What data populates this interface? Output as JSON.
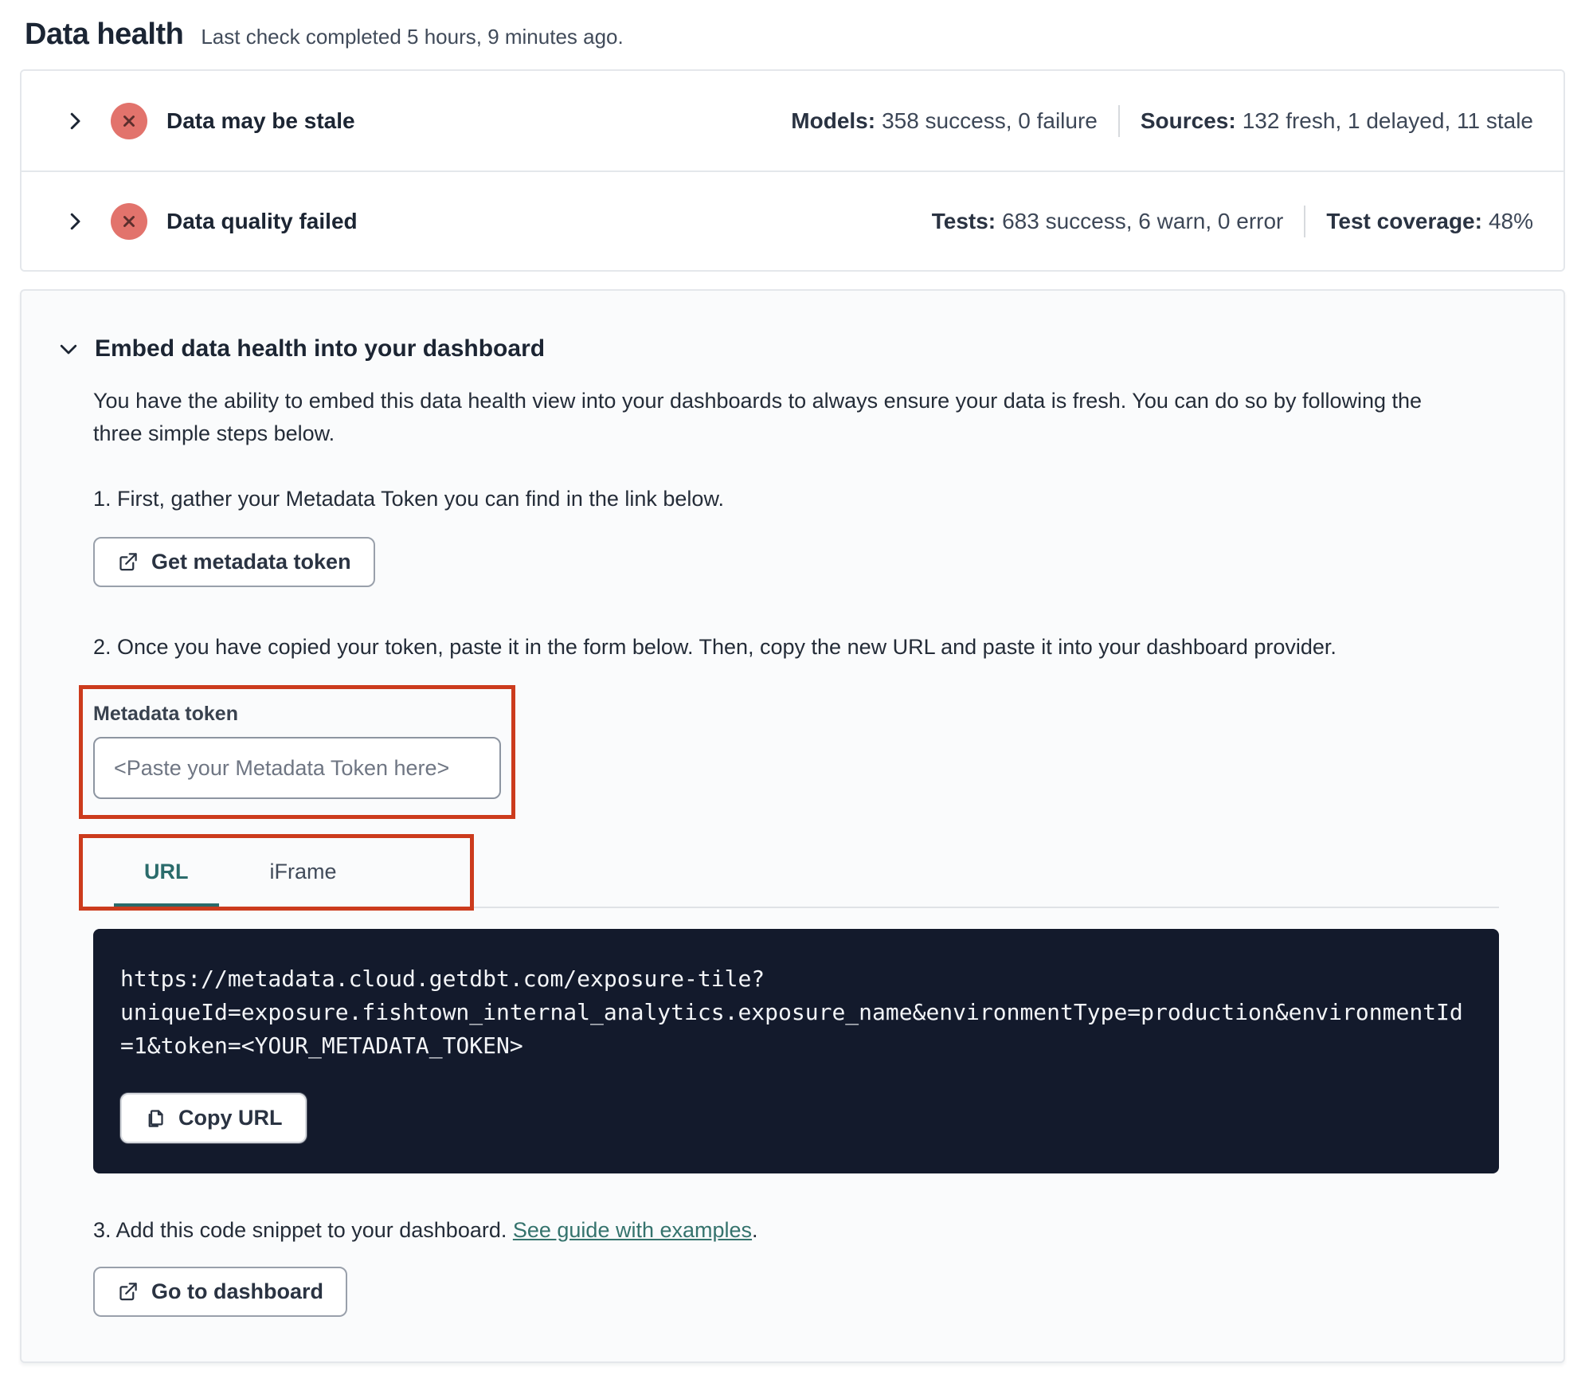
{
  "page": {
    "title": "Data health",
    "subtitle": "Last check completed 5 hours, 9 minutes ago."
  },
  "status_rows": [
    {
      "title": "Data may be stale",
      "stats": [
        {
          "label": "Models:",
          "value": "358 success, 0 failure"
        },
        {
          "label": "Sources:",
          "value": "132 fresh, 1 delayed, 11 stale"
        }
      ]
    },
    {
      "title": "Data quality failed",
      "stats": [
        {
          "label": "Tests:",
          "value": "683 success, 6 warn, 0 error"
        },
        {
          "label": "Test coverage:",
          "value": "48%"
        }
      ]
    }
  ],
  "embed": {
    "title": "Embed data health into your dashboard",
    "description": "You have the ability to embed this data health view into your dashboards to always ensure your data is fresh. You can do so by following the three simple steps below.",
    "step1": {
      "text": "1. First, gather your Metadata Token you can find in the link below.",
      "button_label": "Get metadata token"
    },
    "step2": {
      "text": "2. Once you have copied your token, paste it in the form below. Then, copy the new URL and paste it into your dashboard provider.",
      "token_label": "Metadata token",
      "token_placeholder": "<Paste your Metadata Token here>",
      "token_value": "",
      "tabs": [
        {
          "label": "URL",
          "active": true
        },
        {
          "label": "iFrame",
          "active": false
        }
      ],
      "code_url": "https://metadata.cloud.getdbt.com/exposure-tile?uniqueId=exposure.fishtown_internal_analytics.exposure_name&environmentType=production&environmentId=1&token=<YOUR_METADATA_TOKEN>",
      "code_lines": [
        "https://metadata.cloud.getdbt.com/exposure-tile?",
        "uniqueId=exposure.fishtown_internal_analytics.exposure_name&environmentType=production&environmentId",
        "=1&token=<YOUR_METADATA_TOKEN>"
      ],
      "copy_button_label": "Copy URL"
    },
    "step3": {
      "text_before_link": "3. Add this code snippet to your dashboard. ",
      "link_label": "See guide with examples",
      "text_after_link": ".",
      "button_label": "Go to dashboard"
    }
  },
  "colors": {
    "error_badge_bg": "#e2736c",
    "error_badge_glyph": "#5c2e2c",
    "annotation_red": "#cc3b1d",
    "accent_teal": "#2a6b6b",
    "link_teal": "#35736d",
    "code_bg": "#131a2c",
    "card_border": "#e4e7eb",
    "embed_card_bg": "#fafbfc",
    "heading_text": "#1c2533"
  }
}
